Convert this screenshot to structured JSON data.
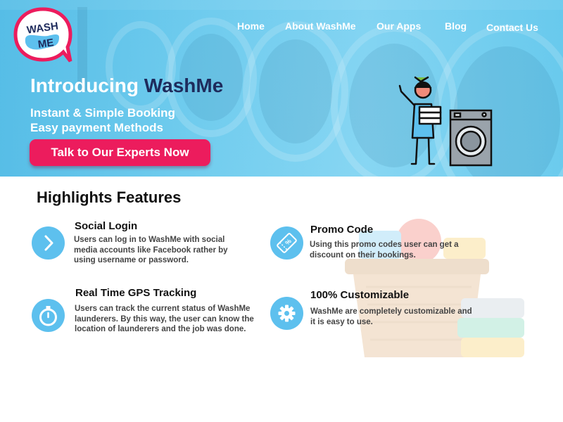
{
  "brand": {
    "logo_line1": "WASH",
    "logo_line2": "ME"
  },
  "nav": {
    "items": [
      {
        "label": "Home"
      },
      {
        "label": "About WashMe"
      },
      {
        "label": "Our Apps"
      },
      {
        "label": "Blog"
      },
      {
        "label": "Contact Us"
      }
    ]
  },
  "hero": {
    "title_prefix": "Introducing",
    "title_brand": "WashMe",
    "line1": "Instant & Simple Booking",
    "line2": "Easy payment Methods",
    "cta_label": "Talk to Our Experts Now"
  },
  "features": {
    "title": "Highlights Features",
    "items": [
      {
        "title": "Social Login",
        "text": "Users can log in to WashMe with social media accounts like Facebook rather by using username or password.",
        "icon": "chevron-right-icon"
      },
      {
        "title": "Promo Code",
        "text": "Using this promo codes user can get a discount on their bookings.",
        "icon": "ticket-icon"
      },
      {
        "title": "Real Time GPS Tracking",
        "text": "Users can track the current status of WashMe launderers. By this way, the user can know the location of launderers and the job was done.",
        "icon": "stopwatch-icon"
      },
      {
        "title": "100% Customizable",
        "text": "WashMe are completely customizable and it is easy to use.",
        "icon": "gear-icon"
      }
    ]
  },
  "colors": {
    "accent": "#ec1c5d",
    "icon_bg": "#5dc0ee",
    "brand_dark": "#1e2b5c",
    "hero_bg": "#6ccbed"
  }
}
